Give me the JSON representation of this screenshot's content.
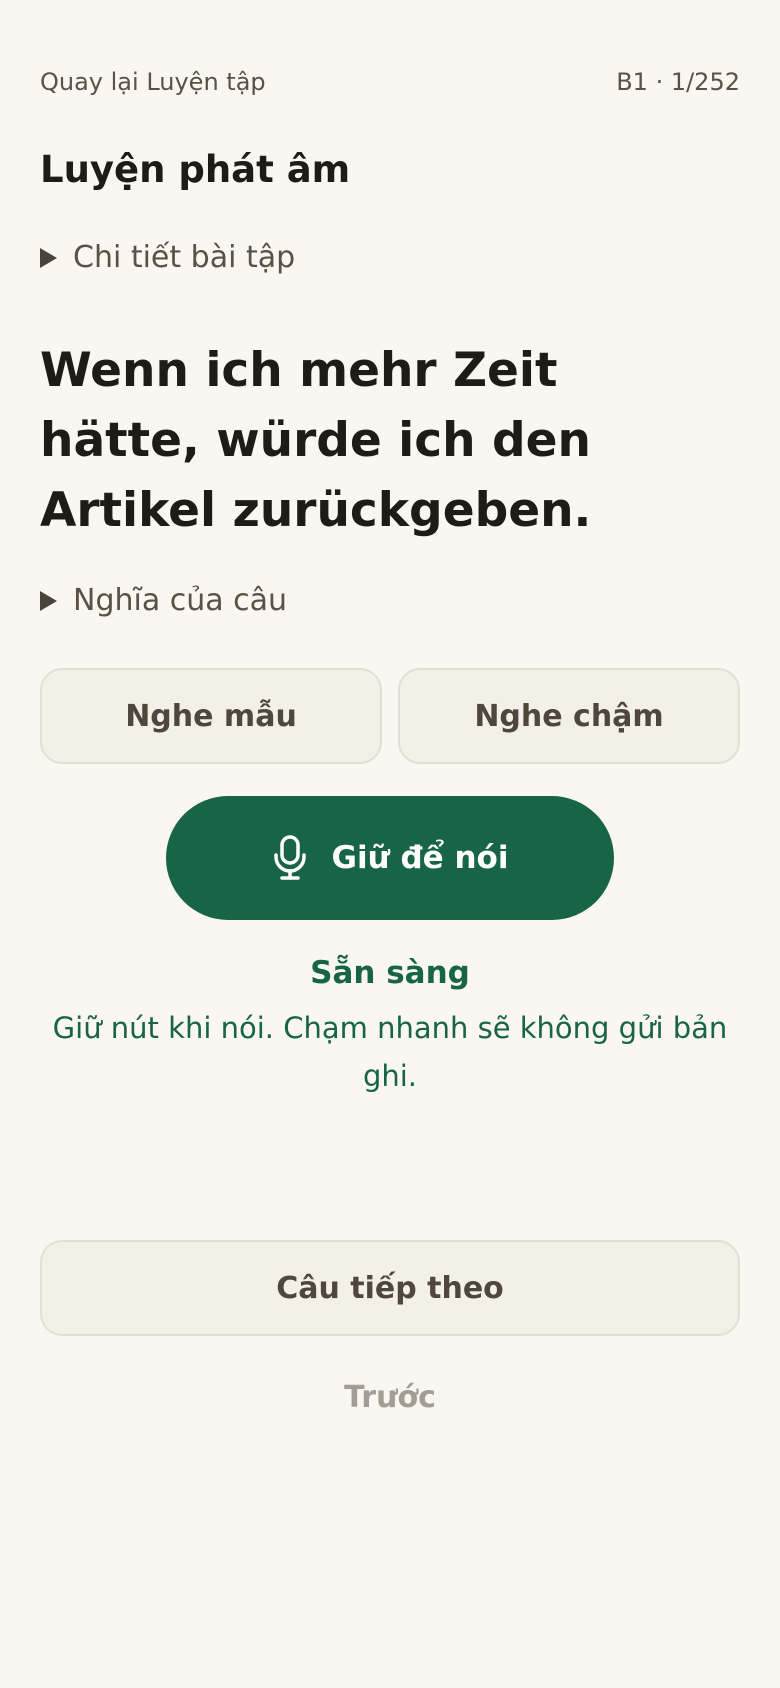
{
  "header": {
    "back_label": "Quay lại Luyện tập",
    "progress": "B1 · 1/252"
  },
  "page_title": "Luyện phát âm",
  "details_toggle": "Chi tiết bài tập",
  "sentence": "Wenn ich mehr Zeit hätte, würde ich den Artikel zurückgeben.",
  "meaning_toggle": "Nghĩa của câu",
  "buttons": {
    "listen_sample": "Nghe mẫu",
    "listen_slow": "Nghe chậm",
    "hold_to_speak": "Giữ để nói",
    "next": "Câu tiếp theo",
    "previous": "Trước"
  },
  "status": {
    "title": "Sẵn sàng",
    "hint": "Giữ nút khi nói. Chạm nhanh sẽ không gửi bản ghi."
  },
  "icons": {
    "microphone": "microphone-icon",
    "disclosure": "triangle-right-icon"
  },
  "colors": {
    "background": "#faf7f2",
    "primary_green": "#186446",
    "button_fill": "#f3f0e8",
    "muted_text": "#a29d95"
  }
}
